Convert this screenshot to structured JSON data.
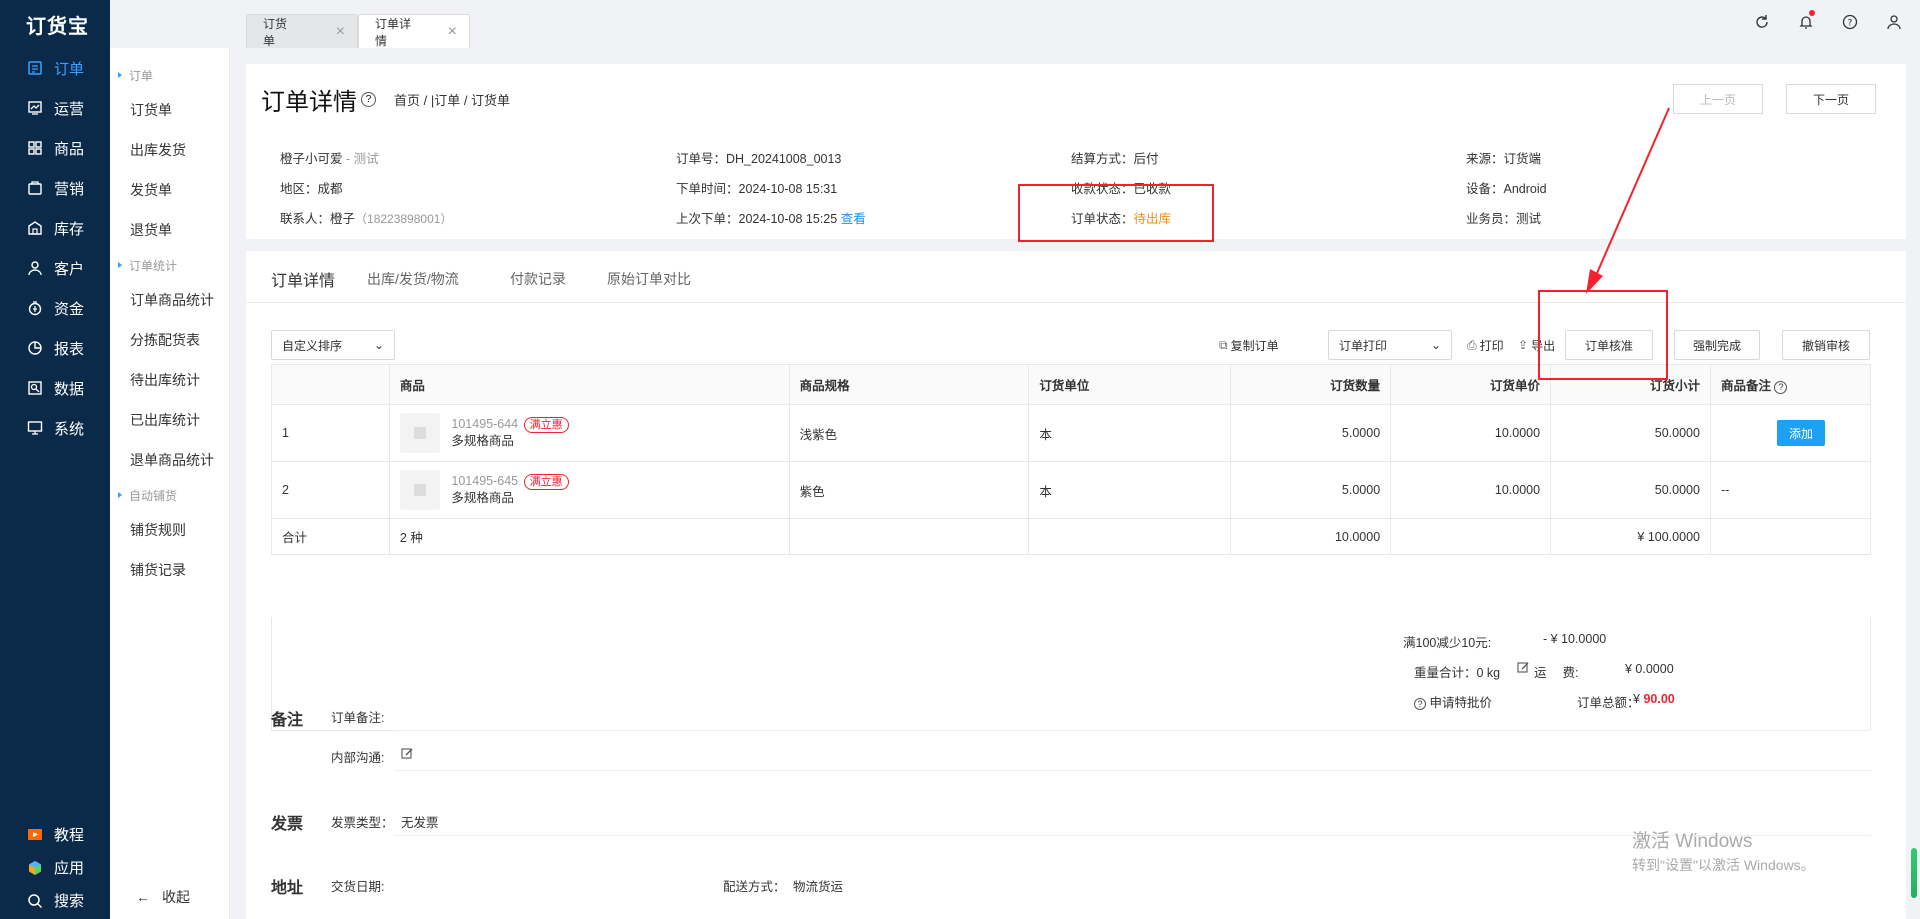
{
  "app": {
    "logo": "订货宝"
  },
  "nav": {
    "items": [
      {
        "label": "订单",
        "icon": "order-icon",
        "active": true
      },
      {
        "label": "运营",
        "icon": "operation-icon"
      },
      {
        "label": "商品",
        "icon": "product-grid-icon"
      },
      {
        "label": "营销",
        "icon": "marketing-icon"
      },
      {
        "label": "库存",
        "icon": "warehouse-icon"
      },
      {
        "label": "客户",
        "icon": "customer-icon"
      },
      {
        "label": "资金",
        "icon": "money-icon"
      },
      {
        "label": "报表",
        "icon": "report-pie-icon"
      },
      {
        "label": "数据",
        "icon": "data-icon"
      },
      {
        "label": "系统",
        "icon": "system-monitor-icon"
      }
    ],
    "bottom": [
      {
        "label": "教程",
        "icon": "tutorial-play-icon"
      },
      {
        "label": "应用",
        "icon": "apps-cube-icon"
      },
      {
        "label": "搜索",
        "icon": "search-icon"
      }
    ]
  },
  "subnav": {
    "group1": "订单",
    "group1_items": [
      "订货单",
      "出库发货",
      "发货单",
      "退货单"
    ],
    "group2": "订单统计",
    "group2_items": [
      "订单商品统计",
      "分拣配货表",
      "待出库统计",
      "已出库统计",
      "退单商品统计"
    ],
    "group3": "自动铺货",
    "group3_items": [
      "铺货规则",
      "铺货记录"
    ],
    "collapse": "收起"
  },
  "tabs": [
    {
      "label": "订货单",
      "active": false
    },
    {
      "label": "订单详情",
      "active": true
    }
  ],
  "page": {
    "title": "订单详情",
    "breadcrumb": "首页 / |订单 / 订货单",
    "prev": "上一页",
    "next": "下一页"
  },
  "info": {
    "customer": "橙子小可爱",
    "customer_tag": " - 测试",
    "region": "地区：成都",
    "contact_label": "联系人：橙子",
    "contact_phone": "（18223898001）",
    "order_no": "订单号：DH_20241008_0013",
    "order_time": "下单时间：2024-10-08 15:31",
    "last_order": "上次下单：2024-10-08 15:25",
    "view": "查看",
    "settle": "结算方式：后付",
    "pay_status": "收款状态：已收款",
    "order_status_label": "订单状态：",
    "order_status": "待出库",
    "source": "来源：订货端",
    "device": "设备：Android",
    "salesman": "业务员：测试"
  },
  "detail_tabs": [
    "订单详情",
    "出库/发货/物流",
    "付款记录",
    "原始订单对比"
  ],
  "toolbar": {
    "sort": "自定义排序",
    "copy": "复制订单",
    "print_sel": "订单打印",
    "print": "打印",
    "export": "导出",
    "approve": "订单核准",
    "force": "强制完成",
    "revoke": "撤销审核"
  },
  "table": {
    "headers": [
      "",
      "商品",
      "商品规格",
      "订货单位",
      "订货数量",
      "订货单价",
      "订货小计",
      "商品备注"
    ],
    "rows": [
      {
        "idx": "1",
        "sku": "101495-644",
        "tag": "满立惠",
        "name": "多规格商品",
        "spec": "浅紫色",
        "unit": "本",
        "qty": "5.0000",
        "price": "10.0000",
        "subtotal": "50.0000",
        "note": "添加"
      },
      {
        "idx": "2",
        "sku": "101495-645",
        "tag": "满立惠",
        "name": "多规格商品",
        "spec": "紫色",
        "unit": "本",
        "qty": "5.0000",
        "price": "10.0000",
        "subtotal": "50.0000",
        "note": "--"
      }
    ],
    "sum": {
      "label": "合计",
      "kinds": "2 种",
      "qty": "10.0000",
      "subtotal": "¥ 100.0000"
    }
  },
  "totals": {
    "discount_label": "满100减少10元:",
    "discount_value": "- ¥ 10.0000",
    "weight": "重量合计：0 kg",
    "freight_label": "运　 费:",
    "freight_value": "¥ 0.0000",
    "apply": "申请特批价",
    "total_label": "订单总额：",
    "total_currency": "¥",
    "total_value": "90.00"
  },
  "remark": {
    "section": "备注",
    "order_note": "订单备注:",
    "internal": "内部沟通:"
  },
  "invoice": {
    "section": "发票",
    "type": "发票类型：",
    "type_value": "无发票"
  },
  "address": {
    "section": "地址",
    "date": "交货日期:",
    "ship": "配送方式：",
    "ship_value": "物流货运"
  },
  "watermark": {
    "line1": "激活 Windows",
    "line2": "转到\"设置\"以激活 Windows。"
  },
  "colors": {
    "nav_bg": "#0b2a4a",
    "accent": "#1890ff",
    "warn": "#fa8c16",
    "annotation": "#f5222d"
  }
}
